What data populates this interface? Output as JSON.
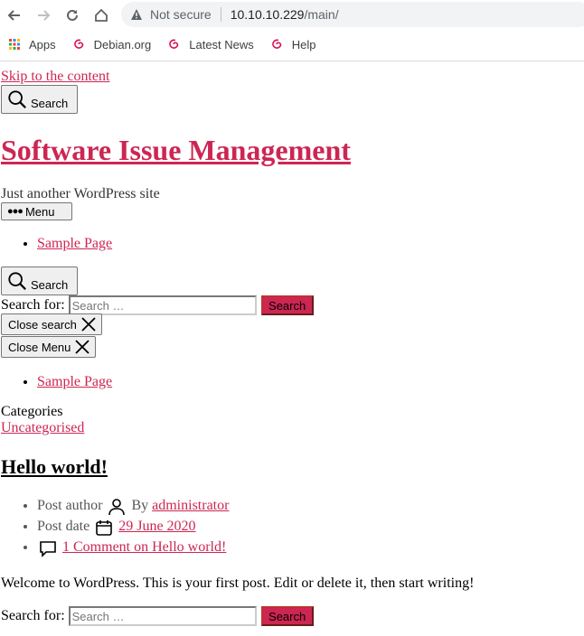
{
  "browser": {
    "not_secure": "Not secure",
    "url_host": "10.10.10.229",
    "url_path": "/main/",
    "bookmarks": [
      {
        "label": "Apps",
        "icon": "apps-grid-icon"
      },
      {
        "label": "Debian.org",
        "icon": "debian-swirl-icon"
      },
      {
        "label": "Latest News",
        "icon": "debian-swirl-icon"
      },
      {
        "label": "Help",
        "icon": "debian-swirl-icon"
      }
    ]
  },
  "page": {
    "skip_link": "Skip to the content",
    "search_toggle": "Search",
    "site_title": "Software Issue Management",
    "site_description": "Just another WordPress site",
    "menu_button": "Menu",
    "nav_primary": [
      "Sample Page"
    ],
    "search_toggle_2": "Search",
    "search_form": {
      "label": "Search for:",
      "placeholder": "Search …",
      "submit": "Search"
    },
    "close_search": "Close search",
    "close_menu": "Close Menu",
    "nav_modal": [
      "Sample Page"
    ],
    "categories_label": "Categories",
    "category": "Uncategorised",
    "post": {
      "title": "Hello world!",
      "author_label": "Post author",
      "author_by": "By",
      "author": "administrator",
      "date_label": "Post date",
      "date": "29 June 2020",
      "comments": "1 Comment on Hello world!",
      "body": "Welcome to WordPress. This is your first post. Edit or delete it, then start writing!"
    },
    "search_form_footer": {
      "label": "Search for:",
      "placeholder": "Search …",
      "submit": "Search"
    }
  },
  "colors": {
    "accent": "#cd2653",
    "chrome_bg": "#f1f3f4"
  }
}
